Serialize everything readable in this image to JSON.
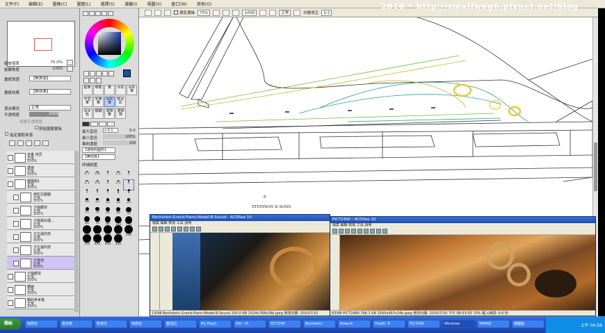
{
  "menubar": [
    "文件(F)",
    "編輯(E)",
    "圖像(C)",
    "圖層(L)",
    "選擇(S)",
    "濾鏡(I)",
    "視圖(V)",
    "窗口(W)",
    "其他(O)"
  ],
  "watermark": "2010 * http://smallwug6.pixnet.net/blog",
  "toolbar": {
    "checkbox_label": "選區邊緣",
    "zoom_select": "75%",
    "rotate_field": "±000",
    "mode_select": "正常",
    "stabilizer_label": "抖動修正",
    "stabilizer_value": "S-2"
  },
  "navigator": {
    "zoom_label": "縮放倍率",
    "zoom_value": "75.0%",
    "angle_label": "旋轉角度",
    "angle_value": "±000"
  },
  "layer_props": {
    "paper_texture_label": "畫紙質感",
    "paper_texture_value": "【無質感】",
    "paper_effect_label": "畫紙效果",
    "paper_effect_value": "【無效果】",
    "blend_label": "混合模式",
    "blend_value": "正常",
    "opacity_label": "不透明度",
    "opacity_value": "100%",
    "protect_label": "保護不透明度",
    "clip_label": "剪貼圖層蒙板",
    "selection_source_label": "指定選取來源"
  },
  "layers": [
    {
      "name": "音量 齊頁",
      "mode": "正常",
      "opacity": "100%",
      "indent": false,
      "selected": false
    },
    {
      "name": "護架",
      "mode": "正常",
      "opacity": "100%",
      "indent": false,
      "selected": false
    },
    {
      "name": "圖層組1",
      "mode": "正常",
      "opacity": "100%",
      "indent": false,
      "selected": false
    },
    {
      "name": "用於拉圖圖",
      "mode": "正常",
      "opacity": "100%",
      "indent": true,
      "selected": false
    },
    {
      "name": "夕陽鋼琴",
      "mode": "正常",
      "opacity": "100%",
      "indent": true,
      "selected": false
    },
    {
      "name": "夕陽黃的裡...",
      "mode": "正常",
      "opacity": "100%",
      "indent": true,
      "selected": false
    },
    {
      "name": "夕左邊的放",
      "mode": "正常",
      "opacity": "100%",
      "indent": true,
      "selected": false
    },
    {
      "name": "夕左邊的放",
      "mode": "正常",
      "opacity": "100%",
      "indent": true,
      "selected": false
    },
    {
      "name": "夕其他",
      "mode": "正常",
      "opacity": "100%",
      "indent": true,
      "selected": true
    },
    {
      "name": "夕陽鋼琴",
      "mode": "正常",
      "opacity": "100%",
      "indent": false,
      "selected": false
    },
    {
      "name": "鋼線",
      "mode": "正常",
      "opacity": "100%",
      "indent": false,
      "selected": false
    },
    {
      "name": "鋼的參考格",
      "mode": "正常",
      "opacity": "100%",
      "indent": false,
      "selected": false
    }
  ],
  "tools": [
    [
      "鉛筆",
      "噴槍",
      "筆",
      "水彩",
      "水彩筆"
    ],
    [
      "平塗筆",
      "毛筆筆",
      "水彩筆",
      "乾水彩"
    ],
    [
      "淡水色",
      "模糊",
      "選擇筆",
      "選擇擦"
    ]
  ],
  "brush": {
    "size_label": "最大直徑",
    "size_mult": "x 0.1",
    "size_value": "9.0",
    "min_size_label": "最小直徑",
    "min_size_value": "100%",
    "density_label": "筆刷濃度",
    "density_value": "100",
    "shape_value": "【通常的圓形】",
    "texture_value": "【無材質】",
    "detail_label": "詳細設置",
    "size_presets": [
      "0.7",
      "0.8",
      "1",
      "1.5",
      "2",
      "2.3",
      "2.6",
      "3",
      "3.5",
      "4",
      "5",
      "6",
      "7",
      "8",
      "9",
      "10",
      "12",
      "14",
      "16",
      "20",
      "25",
      "30",
      "35",
      "40",
      "50",
      "60",
      "70",
      "80",
      "100",
      "120",
      "150",
      "170",
      "200",
      "250",
      "300",
      "350",
      "400",
      "450",
      "500"
    ]
  },
  "canvas": {
    "logo_text": "STEINWAY & SONS"
  },
  "viewer_left": {
    "title": "Bechstein-Grand-Piano-Model-B-Sound - ACDSee 10",
    "menus": "檔案 編輯 檢視 工具 說明",
    "status": "13/98    Bechstein-Grand-Piano-Model-B-Sound    200.0 KB    1024x768x24b jpeg    修改日期: 2010/7/10"
  },
  "viewer_right": {
    "title": "PICT2490 - ACDSee 10",
    "menus": "檔案 編輯 檢視 工具 說明",
    "status": "63/98    PICT2490    796.1 KB    1500x997x24b jpeg    修改日期: 2010/7/10 下午 08:53:55    70%    載入時間: 0.6 秒"
  },
  "taskbar": {
    "start": "開始",
    "tasks": [
      "休閒吉",
      "基本款",
      "新增文",
      "休閒吉",
      "童話記",
      "My Playli",
      "SAI - 4\\",
      "PICT249",
      "Bechstein",
      "Kowa-K",
      "Plastic Tr",
      "PICT249",
      "Windows",
      "YAMAR",
      "繪圖過"
    ],
    "clock": "上午 04:58"
  },
  "colors": {
    "selected_layer": "#cfc4f3",
    "foreground": "#1b4fa8",
    "taskbar": "#2558c8"
  }
}
